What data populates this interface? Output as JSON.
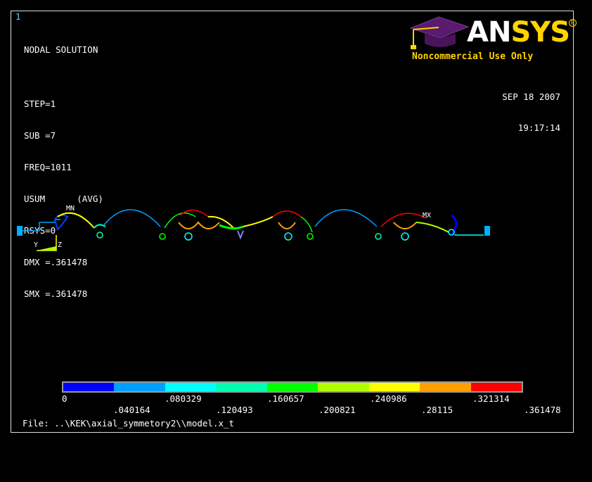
{
  "window_number": "1",
  "title": "NODAL SOLUTION",
  "info_lines": [
    "STEP=1",
    "SUB =7",
    "FREQ=1011",
    "USUM      (AVG)",
    "RSYS=0",
    "DMX =.361478",
    "SMX =.361478"
  ],
  "brand": {
    "logo_text_a": "AN",
    "logo_text_b": "SYS",
    "registered": "R",
    "note": "Noncommercial Use Only"
  },
  "date": "SEP 18 2007",
  "time": "19:17:14",
  "markers": {
    "min": "MN",
    "max": "MX"
  },
  "triad": {
    "y": "Y",
    "z": "Z"
  },
  "legend": {
    "colors": [
      "#0000ff",
      "#00a0ff",
      "#00ffff",
      "#00ffb0",
      "#00ff00",
      "#b0ff00",
      "#ffff00",
      "#ffa000",
      "#ff0000"
    ],
    "labels_top": [
      "0",
      ".080329",
      ".160657",
      ".240986",
      ".321314"
    ],
    "labels_bottom": [
      ".040164",
      ".120493",
      ".200821",
      ".28115",
      ".361478"
    ]
  },
  "file_line": "File: ..\\KEK\\axial_symmetory2\\\\model.x_t"
}
